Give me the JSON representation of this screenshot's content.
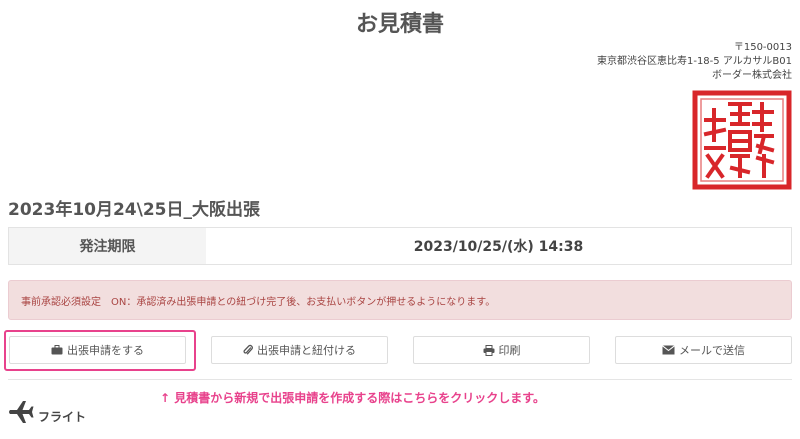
{
  "header": {
    "title": "お見積書"
  },
  "address": {
    "postal": "〒150-0013",
    "street": "東京都渋谷区恵比寿1-18-5 アルカサルB01",
    "company": "ボーダー株式会社"
  },
  "trip": {
    "title": "2023年10月24\\25日_大阪出張"
  },
  "deadline": {
    "label": "発注期限",
    "value": "2023/10/25/(水) 14:38"
  },
  "alert": {
    "text": "事前承認必須設定　ON：承認済み出張申請との紐づけ完了後、お支払いボタンが押せるようになります。"
  },
  "actions": {
    "apply_label": "出張申請をする",
    "link_label": "出張申請と紐付ける",
    "print_label": "印刷",
    "email_label": "メールで送信"
  },
  "hint": {
    "text": "↑ 見積書から新規で出張申請を作成する際はこちらをクリックします。"
  },
  "section": {
    "flight_label": "フライト"
  },
  "colors": {
    "accent": "#e8428c",
    "alert_bg": "#f2dede",
    "alert_text": "#a94442",
    "seal": "#d8262a"
  }
}
